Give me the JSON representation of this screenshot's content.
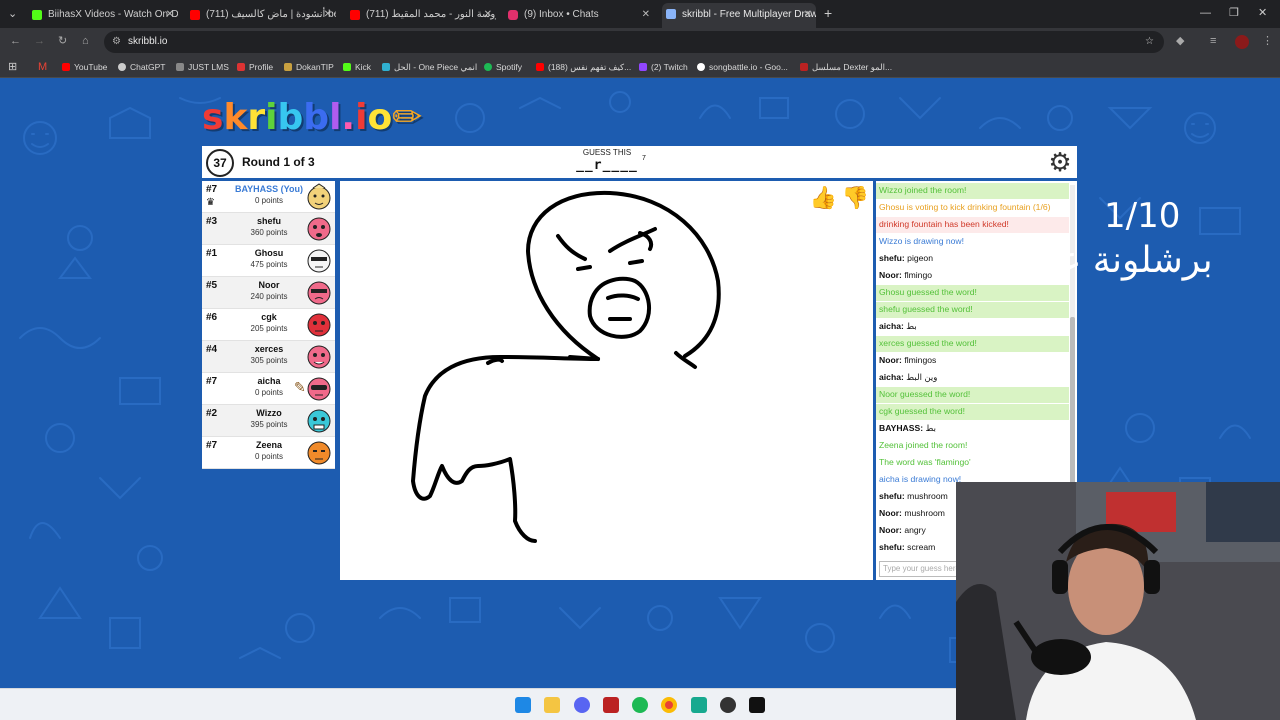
{
  "browser": {
    "tabs": [
      {
        "title": "BiihasX Videos - Watch On-De",
        "icon": "kick-icon",
        "color": "#53fc18"
      },
      {
        "title": "(711) أنشودة | ماض كالسيف be",
        "icon": "youtube-icon",
        "color": "#ff0000"
      },
      {
        "title": "(711) عروسة النور - محمد المقيط",
        "icon": "youtube-icon",
        "color": "#ff0000"
      },
      {
        "title": "(9) Inbox • Chats",
        "icon": "instagram-icon",
        "color": "#e1306c"
      },
      {
        "title": "skribbl - Free Multiplayer Draw",
        "icon": "skribbl-icon",
        "color": "#8ab4f8"
      }
    ],
    "url": "skribbl.io",
    "bookmarks": [
      {
        "label": "YouTube",
        "color": "#ff0000"
      },
      {
        "label": "ChatGPT",
        "color": "#cccccc"
      },
      {
        "label": "JUST LMS",
        "color": "#888888"
      },
      {
        "label": "Profile",
        "color": "#d33"
      },
      {
        "label": "DokanTIP",
        "color": "#c8a040"
      },
      {
        "label": "Kick",
        "color": "#53fc18"
      },
      {
        "label": "الحل - One Piece انمي",
        "color": "#30b0d0"
      },
      {
        "label": "Spotify",
        "color": "#1db954"
      },
      {
        "label": "(188) كيف تفهم نفس...",
        "color": "#ff0000"
      },
      {
        "label": "(2) Twitch",
        "color": "#9146ff"
      },
      {
        "label": "songbattle.io - Goo...",
        "color": "#ffffff"
      },
      {
        "label": "مسلسل Dexter المو...",
        "color": "#b22"
      }
    ]
  },
  "game": {
    "logo": [
      "s",
      "k",
      "r",
      "i",
      "b",
      "b",
      "l",
      ".",
      "i",
      "o"
    ],
    "logo_colors": [
      "#ef3b36",
      "#ff8a2b",
      "#ffe236",
      "#5ed23b",
      "#37c6f0",
      "#3b6cf0",
      "#b05cf0",
      "#ff5bb0",
      "#ef3b36",
      "#ffe236"
    ],
    "timer": "37",
    "round": "Round 1 of 3",
    "guess_label": "GUESS THIS",
    "hint": "__r____",
    "hint_count": "7"
  },
  "players": [
    {
      "rank": "#7",
      "name": "BAYHASS (You)",
      "points": "0 points",
      "you": true,
      "color": "#f2d27a"
    },
    {
      "rank": "#3",
      "name": "shefu",
      "points": "360 points",
      "color": "#f06a8a"
    },
    {
      "rank": "#1",
      "name": "Ghosu",
      "points": "475 points",
      "color": "#f5f5f5"
    },
    {
      "rank": "#5",
      "name": "Noor",
      "points": "240 points",
      "color": "#f06a8a"
    },
    {
      "rank": "#6",
      "name": "cgk",
      "points": "205 points",
      "color": "#e0303a"
    },
    {
      "rank": "#4",
      "name": "xerces",
      "points": "305 points",
      "color": "#f06a8a"
    },
    {
      "rank": "#7",
      "name": "aicha",
      "points": "0 points",
      "color": "#f06a8a"
    },
    {
      "rank": "#2",
      "name": "Wizzo",
      "points": "395 points",
      "color": "#3ac8d8"
    },
    {
      "rank": "#7",
      "name": "Zeena",
      "points": "0 points",
      "color": "#f08a2a"
    }
  ],
  "chat": [
    {
      "type": "green",
      "text": "Wizzo joined the room!"
    },
    {
      "type": "orange",
      "text": "Ghosu is voting to kick drinking fountain (1/6)"
    },
    {
      "type": "red",
      "text": "drinking fountain has been kicked!"
    },
    {
      "type": "blue",
      "text": "Wizzo is drawing now!"
    },
    {
      "type": "user",
      "user": "shefu:",
      "text": "pigeon"
    },
    {
      "type": "user",
      "user": "Noor:",
      "text": "flmingo"
    },
    {
      "type": "green",
      "text": "Ghosu guessed the word!"
    },
    {
      "type": "green",
      "text": "shefu guessed the word!"
    },
    {
      "type": "user",
      "user": "aicha:",
      "text": "بط"
    },
    {
      "type": "green",
      "text": "xerces guessed the word!"
    },
    {
      "type": "user",
      "user": "Noor:",
      "text": "flmingos"
    },
    {
      "type": "user",
      "user": "aicha:",
      "text": "وين البط"
    },
    {
      "type": "green",
      "text": "Noor guessed the word!"
    },
    {
      "type": "green",
      "text": "cgk guessed the word!"
    },
    {
      "type": "user",
      "user": "BAYHASS:",
      "text": "بط"
    },
    {
      "type": "green",
      "text": "Zeena joined the room!"
    },
    {
      "type": "green",
      "text": "The word was 'flamingo'"
    },
    {
      "type": "blue",
      "text": "aicha is drawing now!"
    },
    {
      "type": "user",
      "user": "shefu:",
      "text": "mushroom"
    },
    {
      "type": "user",
      "user": "Noor:",
      "text": "mushroom"
    },
    {
      "type": "user",
      "user": "Noor:",
      "text": "angry"
    },
    {
      "type": "user",
      "user": "shefu:",
      "text": "scream"
    }
  ],
  "chat_placeholder": "Type your guess here...",
  "overlay": {
    "counter": "1/10",
    "caption": "برشلونة عاهات"
  }
}
